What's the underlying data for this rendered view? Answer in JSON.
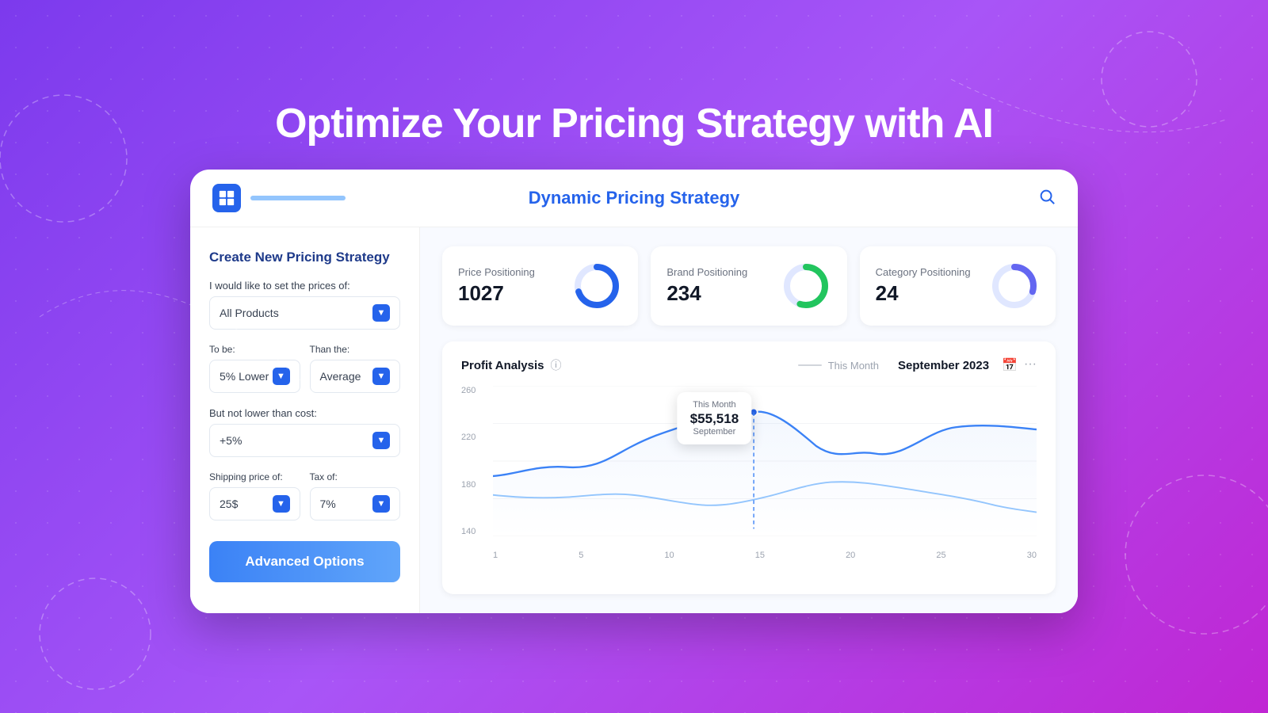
{
  "page": {
    "title": "Optimize Your Pricing Strategy with AI",
    "background": "purple-gradient"
  },
  "card": {
    "header": {
      "title": "Dynamic Pricing Strategy",
      "search_icon": "🔍"
    },
    "sidebar": {
      "title": "Create New Pricing Strategy",
      "price_label": "I would like to set the prices of:",
      "product_select": "All Products",
      "to_be_label": "To be:",
      "to_be_value": "5% Lower",
      "than_the_label": "Than the:",
      "than_the_value": "Average",
      "not_lower_label": "But not lower than cost:",
      "not_lower_value": "+5%",
      "shipping_label": "Shipping price of:",
      "shipping_value": "25$",
      "tax_label": "Tax of:",
      "tax_value": "7%",
      "advanced_btn": "Advanced Options"
    },
    "kpis": [
      {
        "label": "Price Positioning",
        "value": "1027",
        "chart_color": "#2563eb",
        "chart_bg": "#e0e7ff",
        "percent": 70
      },
      {
        "label": "Brand Positioning",
        "value": "234",
        "chart_color": "#22c55e",
        "chart_bg": "#e0e7ff",
        "percent": 55
      },
      {
        "label": "Category Positioning",
        "value": "24",
        "chart_color": "#6366f1",
        "chart_bg": "#e0e7ff",
        "percent": 30
      }
    ],
    "chart": {
      "title": "Profit Analysis",
      "legend_label": "This Month",
      "date": "September 2023",
      "tooltip": {
        "label": "This Month",
        "value": "$55,518",
        "sub": "September"
      },
      "y_labels": [
        "260",
        "220",
        "180",
        "140"
      ],
      "x_labels": [
        "1",
        "5",
        "10",
        "15",
        "20",
        "25",
        "30"
      ]
    }
  }
}
